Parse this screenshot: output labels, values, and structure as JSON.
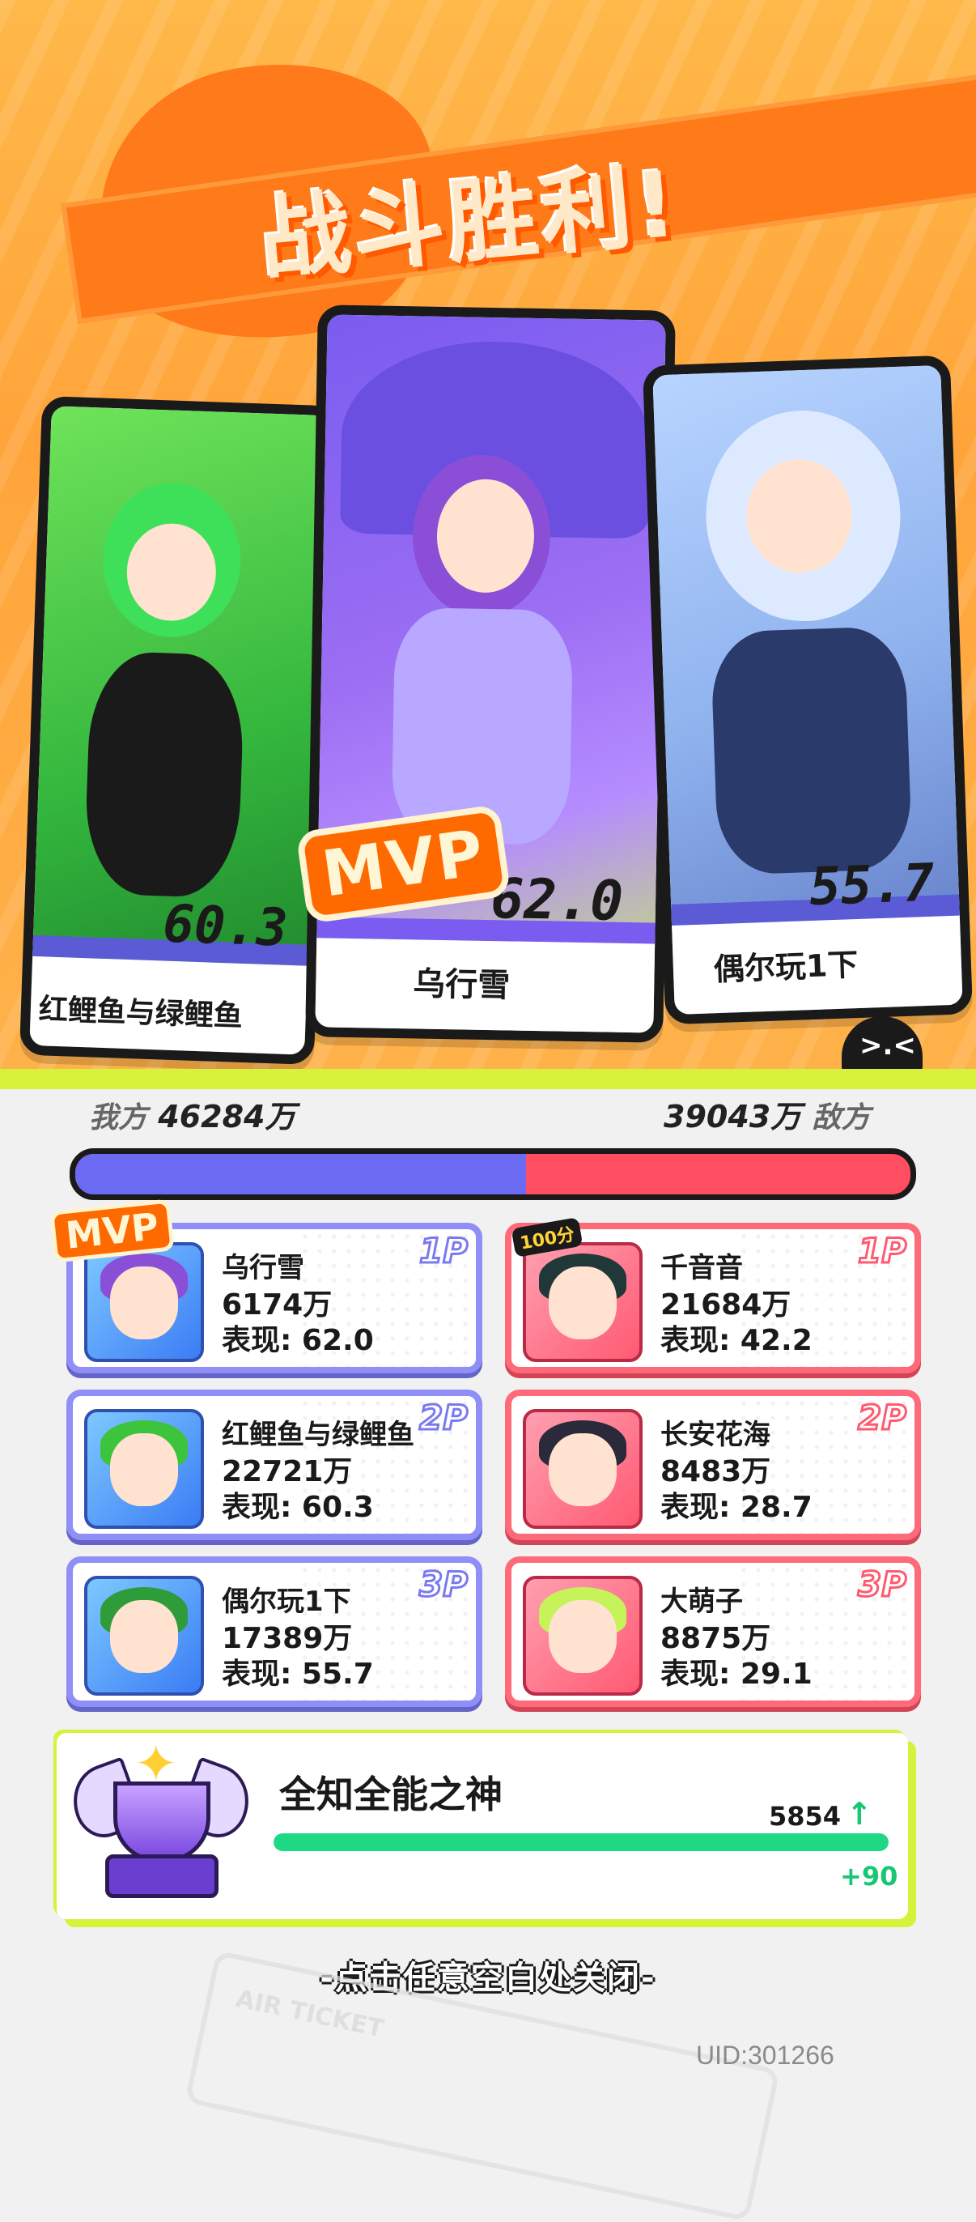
{
  "header": {
    "title": "战斗胜利!"
  },
  "podium": [
    {
      "name": "红鲤鱼与绿鲤鱼",
      "score": "60.3",
      "accent": "#5b5bd6"
    },
    {
      "name": "乌行雪",
      "score": "62.0",
      "accent": "#7a5cf0",
      "mvp": "MVP"
    },
    {
      "name": "偶尔玩1下",
      "score": "55.7",
      "accent": "#5b5bd6"
    }
  ],
  "helmet_face": ">.<",
  "summary": {
    "ally_label": "我方",
    "ally_total": "46284万",
    "enemy_total": "39043万",
    "enemy_label": "敌方",
    "ally_share": 0.54,
    "ally_color": "#6a6af2",
    "enemy_color": "#ff4d62"
  },
  "mvp_badge": "MVP",
  "badge_100": "100分",
  "allies": [
    {
      "rank": "1P",
      "name": "乌行雪",
      "score": "6174万",
      "perf": "表现: 62.0",
      "hair": "#8a4fd6"
    },
    {
      "rank": "2P",
      "name": "红鲤鱼与绿鲤鱼",
      "score": "22721万",
      "perf": "表现: 60.3",
      "hair": "#3cc43c"
    },
    {
      "rank": "3P",
      "name": "偶尔玩1下",
      "score": "17389万",
      "perf": "表现: 55.7",
      "hair": "#2e9c3a"
    }
  ],
  "enemies": [
    {
      "rank": "1P",
      "name": "千音音",
      "score": "21684万",
      "perf": "表现: 42.2",
      "hair": "#203838"
    },
    {
      "rank": "2P",
      "name": "长安花海",
      "score": "8483万",
      "perf": "表现: 28.7",
      "hair": "#2a2a3a"
    },
    {
      "rank": "3P",
      "name": "大萌子",
      "score": "8875万",
      "perf": "表现: 29.1",
      "hair": "#c6f25a"
    }
  ],
  "rank_panel": {
    "title": "全知全能之神",
    "points": "5854",
    "up_arrow": "↑",
    "delta": "+90",
    "progress": 1.0,
    "color": "#1ed884"
  },
  "close_hint": "-点击任意空白处关闭-",
  "uid": "UID:301266",
  "ticket_text": "AIR TICKET"
}
